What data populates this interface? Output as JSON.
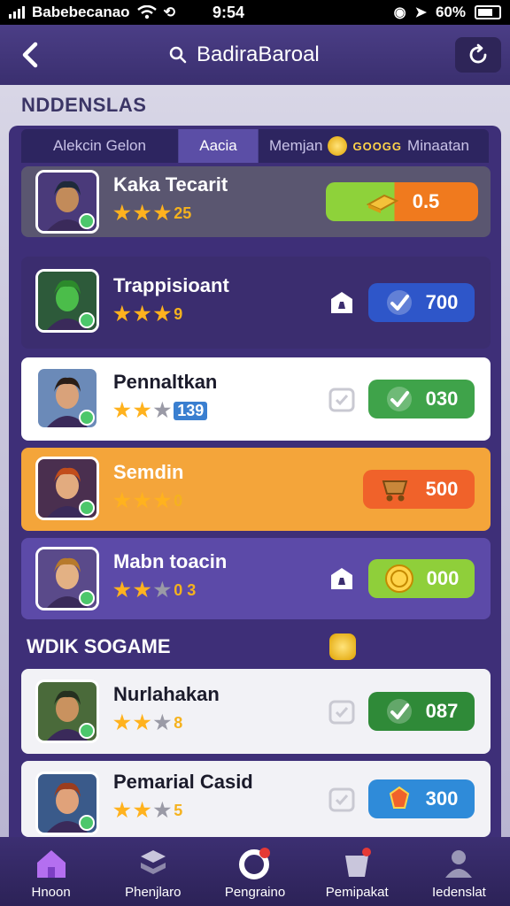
{
  "status_bar": {
    "carrier": "Babebecanao",
    "time": "9:54",
    "battery": "60%",
    "icons": [
      "signal-icon",
      "wifi-icon",
      "sync-icon",
      "alarm-icon",
      "location-icon",
      "battery-icon"
    ]
  },
  "header": {
    "back_icon": "chevron-left-icon",
    "search_icon": "search-icon",
    "search_text": "BadiraBaroal",
    "refresh_icon": "refresh-icon"
  },
  "section_title": "NDDENSLAS",
  "tabs": [
    {
      "label": "Alekcin Gelon",
      "active": false
    },
    {
      "label": "Aacia",
      "active": true
    },
    {
      "label": "Memjan",
      "badge": "GOOGG",
      "extra": "Minaatan",
      "active": false
    }
  ],
  "rows": [
    {
      "title": "Kaka Tecarit",
      "stars": 3,
      "rating_text": "25",
      "button_value": "0.5",
      "button_icon": "gold-bars-icon",
      "theme": "gray",
      "side_icon": ""
    },
    {
      "title": "Trappisioant",
      "stars": 3,
      "rating_text": "9",
      "button_value": "700",
      "button_icon": "checkmark-icon",
      "theme": "purple-dark",
      "side_icon": "chess-piece-icon"
    },
    {
      "title": "Pennaltkan",
      "stars": 2,
      "rating_text": "139",
      "button_value": "030",
      "button_icon": "checkmark-icon",
      "theme": "white",
      "side_icon": "badge-icon"
    },
    {
      "title": "Semdin",
      "stars": 3,
      "rating_text": "0",
      "button_value": "500",
      "button_icon": "cart-icon",
      "theme": "orange",
      "side_icon": ""
    },
    {
      "title": "Mabn toacin",
      "stars": 2,
      "rating_text": "0 3",
      "button_value": "000",
      "button_icon": "coin-icon",
      "theme": "purple",
      "side_icon": "chess-piece-icon"
    },
    {
      "title": "Nurlahakan",
      "stars": 2,
      "rating_text": "8",
      "button_value": "087",
      "button_icon": "checkmark-icon",
      "theme": "white",
      "side_icon": "badge-icon"
    },
    {
      "title": "Pemarial Casid",
      "stars": 2,
      "rating_text": "5",
      "button_value": "300",
      "button_icon": "gem-icon",
      "theme": "white",
      "side_icon": "badge-icon"
    }
  ],
  "section_title_2": "WDIK SOGAME",
  "bottom_nav": [
    {
      "label": "Hnoon",
      "icon": "home-icon",
      "active": false
    },
    {
      "label": "Phenjlaro",
      "icon": "stack-icon",
      "active": false
    },
    {
      "label": "Pengraino",
      "icon": "ring-icon",
      "active": true
    },
    {
      "label": "Pemipakat",
      "icon": "bucket-icon",
      "active": false
    },
    {
      "label": "Iedenslat",
      "icon": "user-icon",
      "active": false
    }
  ],
  "colors": {
    "header": "#4b3e86",
    "panel": "#3e2f78",
    "button_green": "#3fa34a",
    "button_blue": "#2e56c9",
    "button_orange": "#f0622a",
    "star": "#ffb21e"
  }
}
